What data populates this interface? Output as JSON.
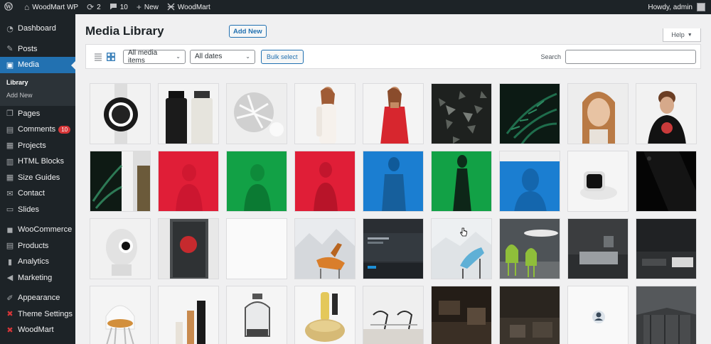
{
  "admin_bar": {
    "site_name": "WoodMart WP",
    "updates_count": "2",
    "comments_count": "10",
    "new_label": "New",
    "plugin_label": "WoodMart",
    "greeting": "Howdy, admin"
  },
  "sidebar": {
    "items": [
      {
        "label": "Dashboard",
        "icon": "dashboard-icon"
      },
      {
        "label": "Posts",
        "icon": "pin-icon"
      },
      {
        "label": "Media",
        "icon": "media-icon"
      },
      {
        "label": "Pages",
        "icon": "pages-icon"
      },
      {
        "label": "Comments",
        "icon": "comments-icon",
        "badge": "10"
      },
      {
        "label": "Projects",
        "icon": "folder-icon"
      },
      {
        "label": "HTML Blocks",
        "icon": "blocks-icon"
      },
      {
        "label": "Size Guides",
        "icon": "table-icon"
      },
      {
        "label": "Contact",
        "icon": "mail-icon"
      },
      {
        "label": "Slides",
        "icon": "slides-icon"
      },
      {
        "label": "WooCommerce",
        "icon": "woo-icon"
      },
      {
        "label": "Products",
        "icon": "archive-icon"
      },
      {
        "label": "Analytics",
        "icon": "chart-icon"
      },
      {
        "label": "Marketing",
        "icon": "megaphone-icon"
      },
      {
        "label": "Appearance",
        "icon": "brush-icon"
      },
      {
        "label": "Theme Settings",
        "icon": "woodmart-icon"
      },
      {
        "label": "WoodMart",
        "icon": "woodmart-icon"
      }
    ],
    "media_submenu": [
      "Library",
      "Add New"
    ]
  },
  "main": {
    "title": "Media Library",
    "add_new": "Add New",
    "help": "Help",
    "filter_type": "All media items",
    "filter_date": "All dates",
    "bulk_select": "Bulk select",
    "search_label": "Search",
    "search_value": ""
  },
  "colors": {
    "accent": "#2271b1",
    "sidebar_bg": "#1d2327",
    "badge": "#d63638"
  }
}
